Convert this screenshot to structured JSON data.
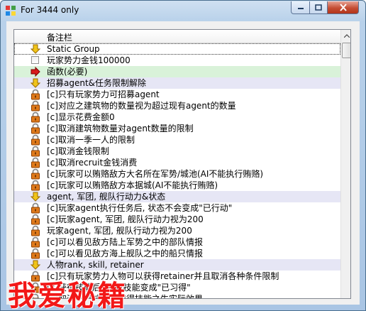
{
  "window": {
    "title": "For 3444 only"
  },
  "list": {
    "header": "备注栏",
    "rows": [
      {
        "type": "group",
        "icon": "arrow-down-icon",
        "label": "Static Group",
        "selected": true
      },
      {
        "type": "item",
        "icon": "checkbox",
        "label": "玩家势力金钱100000"
      },
      {
        "type": "highlight",
        "icon": "arrow-right-icon",
        "label": "函数(必要)"
      },
      {
        "type": "group",
        "icon": "arrow-down-icon",
        "label": "招募agent&任务限制解除"
      },
      {
        "type": "item",
        "icon": "lock-icon",
        "label": "[c]只有玩家势力可招募agent"
      },
      {
        "type": "item",
        "icon": "lock-icon",
        "label": "[c]对应之建筑物的数量视为超过现有agent的数量"
      },
      {
        "type": "item",
        "icon": "lock-icon",
        "label": "[c]显示花费金额0"
      },
      {
        "type": "item",
        "icon": "lock-icon",
        "label": "[c]取消建筑物数量对agent数量的限制"
      },
      {
        "type": "item",
        "icon": "lock-icon",
        "label": "[c]取消一季一人的限制"
      },
      {
        "type": "item",
        "icon": "lock-icon",
        "label": "[c]取消金钱限制"
      },
      {
        "type": "item",
        "icon": "lock-icon",
        "label": "[c]取消recruit金钱消费"
      },
      {
        "type": "item",
        "icon": "lock-icon",
        "label": "[c]玩家可以贿赂敌方大名所在军势/城池(AI不能执行贿赂)"
      },
      {
        "type": "item",
        "icon": "lock-icon",
        "label": "[c]玩家可以贿赂敌方本据城(AI不能执行贿赂)"
      },
      {
        "type": "group",
        "icon": "arrow-down-icon",
        "label": "agent, 军团, 舰队行动力&状态"
      },
      {
        "type": "item",
        "icon": "lock-icon",
        "label": "[c]玩家agent执行任务后, 状态不会变成\"已行动\""
      },
      {
        "type": "item",
        "icon": "lock-icon",
        "label": "[c]玩家agent, 军团, 舰队行动力视为200"
      },
      {
        "type": "item",
        "icon": "lock-icon",
        "label": "玩家agent, 军团, 舰队行动力视为200"
      },
      {
        "type": "item",
        "icon": "lock-icon",
        "label": "[c]可以看见敌方陆上军势之中的部队情报"
      },
      {
        "type": "item",
        "icon": "lock-icon",
        "label": "[c]可以看见敌方海上舰队之中的船只情报"
      },
      {
        "type": "group",
        "icon": "arrow-down-icon",
        "label": "人物rank, skill, retainer"
      },
      {
        "type": "item",
        "icon": "lock-icon",
        "label": "[c]只有玩家势力人物可以获得retainer并且取消各种条件限制"
      },
      {
        "type": "item",
        "icon": "lock-icon",
        "label": "[c]获得技能后, 所有技能变成\"已习得\""
      },
      {
        "type": "item",
        "icon": "lock-icon",
        "label": "[c]取消所有技能已习得技能之生实际效果"
      }
    ]
  },
  "watermark": {
    "text": "我爱秘籍"
  },
  "colors": {
    "group_bg": "#e6e6f5",
    "highlight_bg": "#d9f2d9",
    "watermark": "#f21818"
  }
}
